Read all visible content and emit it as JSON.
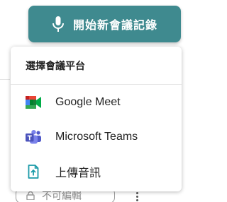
{
  "start_button": {
    "label": "開始新會議記錄",
    "icon": "microphone-icon"
  },
  "menu": {
    "header": "選擇會議平台",
    "items": [
      {
        "label": "Google Meet",
        "icon": "google-meet-icon"
      },
      {
        "label": "Microsoft Teams",
        "icon": "microsoft-teams-icon"
      },
      {
        "label": "上傳音訊",
        "icon": "upload-file-icon"
      }
    ]
  },
  "background": {
    "chip_label": "不可編輯"
  },
  "colors": {
    "accent": "#3f8a8f",
    "upload_icon": "#1a9aa8"
  }
}
